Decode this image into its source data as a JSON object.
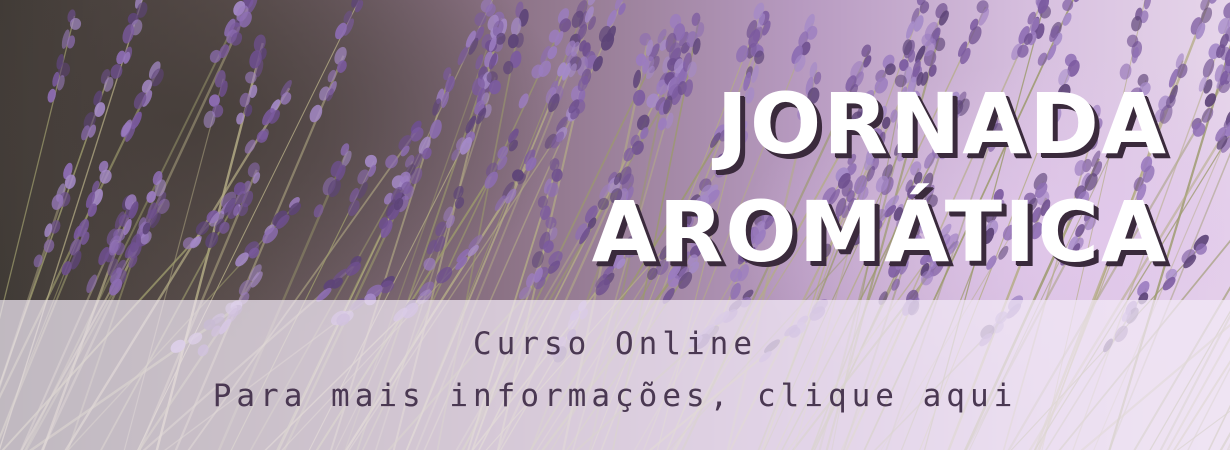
{
  "banner": {
    "title_line1": "JORNADA",
    "title_line2": "AROMÁTICA",
    "subtitle": "Curso Online",
    "cta": "Para mais informações, clique aqui"
  },
  "colors": {
    "title": "#ffffff",
    "title_shadow": "#3a2a3c",
    "info_text": "#4a3852",
    "info_bar": "#f3eaf6",
    "lavender": "#8b6bb0"
  }
}
